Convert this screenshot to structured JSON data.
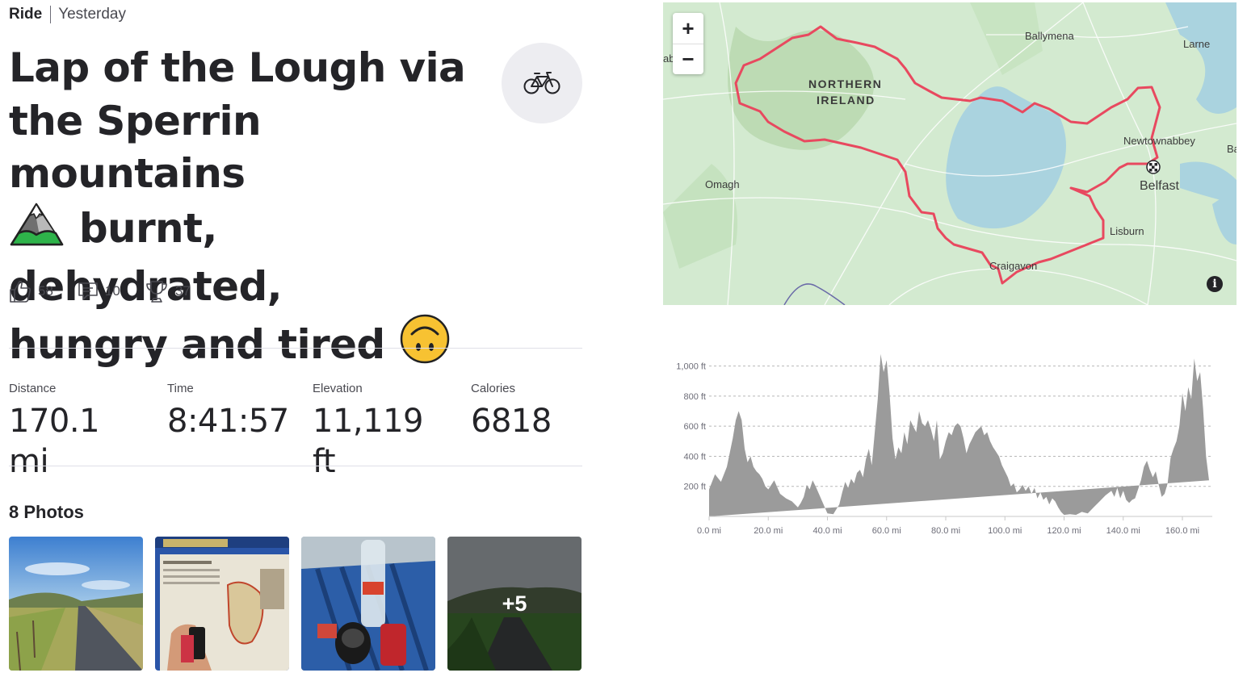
{
  "activity": {
    "type": "Ride",
    "when": "Yesterday",
    "title_line1": "Lap of the Lough via",
    "title_line2": "the Sperrin mountains",
    "title_line3": "burnt, dehydrated,",
    "title_line4": "hungry and tired",
    "sport_icon": "bike-icon"
  },
  "social": {
    "kudos": "58",
    "comments": "10",
    "achievements": "37"
  },
  "stats": [
    {
      "label": "Distance",
      "value": "170.1 mi"
    },
    {
      "label": "Time",
      "value": "8:41:57"
    },
    {
      "label": "Elevation",
      "value": "11,119 ft"
    },
    {
      "label": "Calories",
      "value": "6818"
    }
  ],
  "photos": {
    "title": "8 Photos",
    "more_label": "+5"
  },
  "map": {
    "zoom_in": "+",
    "zoom_out": "−",
    "info": "i",
    "labels": {
      "region_line1": "NORTHERN",
      "region_line2": "IRELAND",
      "ballymena": "Ballymena",
      "larne": "Larne",
      "newtownabbey": "Newtownabbey",
      "belfast": "Belfast",
      "omagh": "Omagh",
      "lisburn": "Lisburn",
      "craigavon": "Craigavon",
      "edge_left": "ab",
      "edge_right": "Ba"
    },
    "route_color": "#e8495f"
  },
  "chart_data": {
    "type": "area",
    "x_unit": "mi",
    "y_unit": "ft",
    "xlim": [
      0,
      170.1
    ],
    "ylim": [
      0,
      1100
    ],
    "x_ticks": [
      "0.0 mi",
      "20.0 mi",
      "40.0 mi",
      "60.0 mi",
      "80.0 mi",
      "100.0 mi",
      "120.0 mi",
      "140.0 mi",
      "160.0 mi"
    ],
    "y_ticks": [
      "200 ft",
      "400 ft",
      "600 ft",
      "800 ft",
      "1,000 ft"
    ],
    "x": [
      0,
      2,
      4,
      6,
      8,
      9,
      10,
      11,
      12,
      13,
      14,
      15,
      16,
      17,
      18,
      19,
      20,
      22,
      24,
      26,
      28,
      30,
      31,
      32,
      33,
      34,
      35,
      36,
      38,
      40,
      42,
      44,
      45,
      46,
      47,
      48,
      49,
      50,
      51,
      52,
      53,
      54,
      55,
      56,
      57,
      58,
      59,
      60,
      61,
      62,
      63,
      64,
      65,
      66,
      67,
      68,
      69,
      70,
      71,
      72,
      73,
      74,
      75,
      76,
      77,
      78,
      79,
      80,
      81,
      82,
      83,
      84,
      85,
      86,
      87,
      88,
      89,
      90,
      91,
      92,
      93,
      94,
      95,
      96,
      97,
      98,
      99,
      100,
      101,
      102,
      103,
      104,
      105,
      106,
      107,
      108,
      109,
      110,
      111,
      112,
      113,
      114,
      115,
      116,
      117,
      118,
      119,
      120,
      122,
      124,
      126,
      128,
      130,
      132,
      134,
      136,
      137,
      138,
      139,
      140,
      141,
      142,
      143,
      144,
      145,
      146,
      147,
      148,
      149,
      150,
      151,
      152,
      153,
      154,
      155,
      156,
      157,
      158,
      159,
      160,
      161,
      162,
      163,
      164,
      165,
      166,
      167,
      168,
      169,
      170.1
    ],
    "y": [
      180,
      280,
      230,
      330,
      520,
      640,
      700,
      640,
      450,
      360,
      400,
      330,
      300,
      280,
      250,
      200,
      180,
      240,
      150,
      120,
      100,
      60,
      90,
      130,
      210,
      180,
      240,
      200,
      110,
      20,
      15,
      80,
      160,
      230,
      190,
      250,
      220,
      290,
      310,
      260,
      380,
      450,
      340,
      560,
      780,
      1080,
      960,
      1040,
      820,
      520,
      380,
      460,
      420,
      560,
      480,
      640,
      600,
      560,
      700,
      620,
      600,
      640,
      580,
      500,
      640,
      380,
      420,
      500,
      560,
      540,
      600,
      620,
      600,
      520,
      420,
      480,
      520,
      560,
      580,
      600,
      540,
      560,
      500,
      460,
      430,
      400,
      340,
      300,
      260,
      200,
      220,
      160,
      180,
      210,
      170,
      200,
      150,
      190,
      120,
      160,
      110,
      130,
      80,
      120,
      100,
      60,
      30,
      10,
      15,
      10,
      30,
      20,
      60,
      100,
      140,
      170,
      130,
      190,
      120,
      170,
      110,
      90,
      110,
      120,
      180,
      240,
      330,
      370,
      310,
      260,
      300,
      210,
      130,
      150,
      220,
      390,
      450,
      500,
      600,
      820,
      700,
      860,
      780,
      1050,
      900,
      960,
      720,
      400,
      240
    ]
  }
}
